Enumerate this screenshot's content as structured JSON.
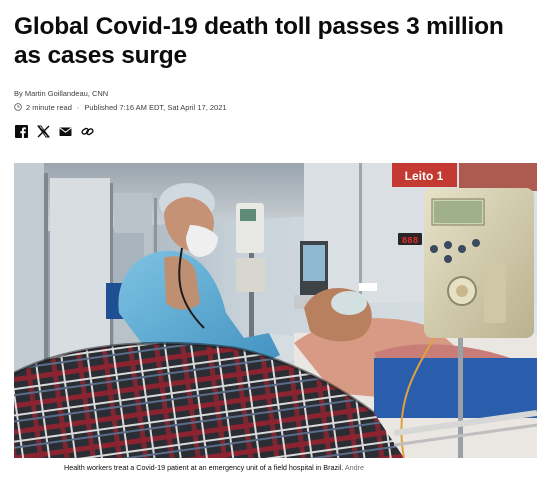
{
  "article": {
    "headline": "Global Covid-19 death toll passes 3 million as cases surge",
    "byline": "By Martin Goillandeau, CNN",
    "read_time": "2 minute read",
    "published": "Published 7:16 AM EDT, Sat April 17, 2021",
    "share_icons": [
      "facebook-icon",
      "x-icon",
      "email-icon",
      "link-icon"
    ],
    "image": {
      "sign_text": "Leito 1",
      "pump_display": "888"
    },
    "caption": "Health workers treat a Covid-19 patient at an emergency unit of a field hospital in Brazil.",
    "credit": "Andre"
  }
}
